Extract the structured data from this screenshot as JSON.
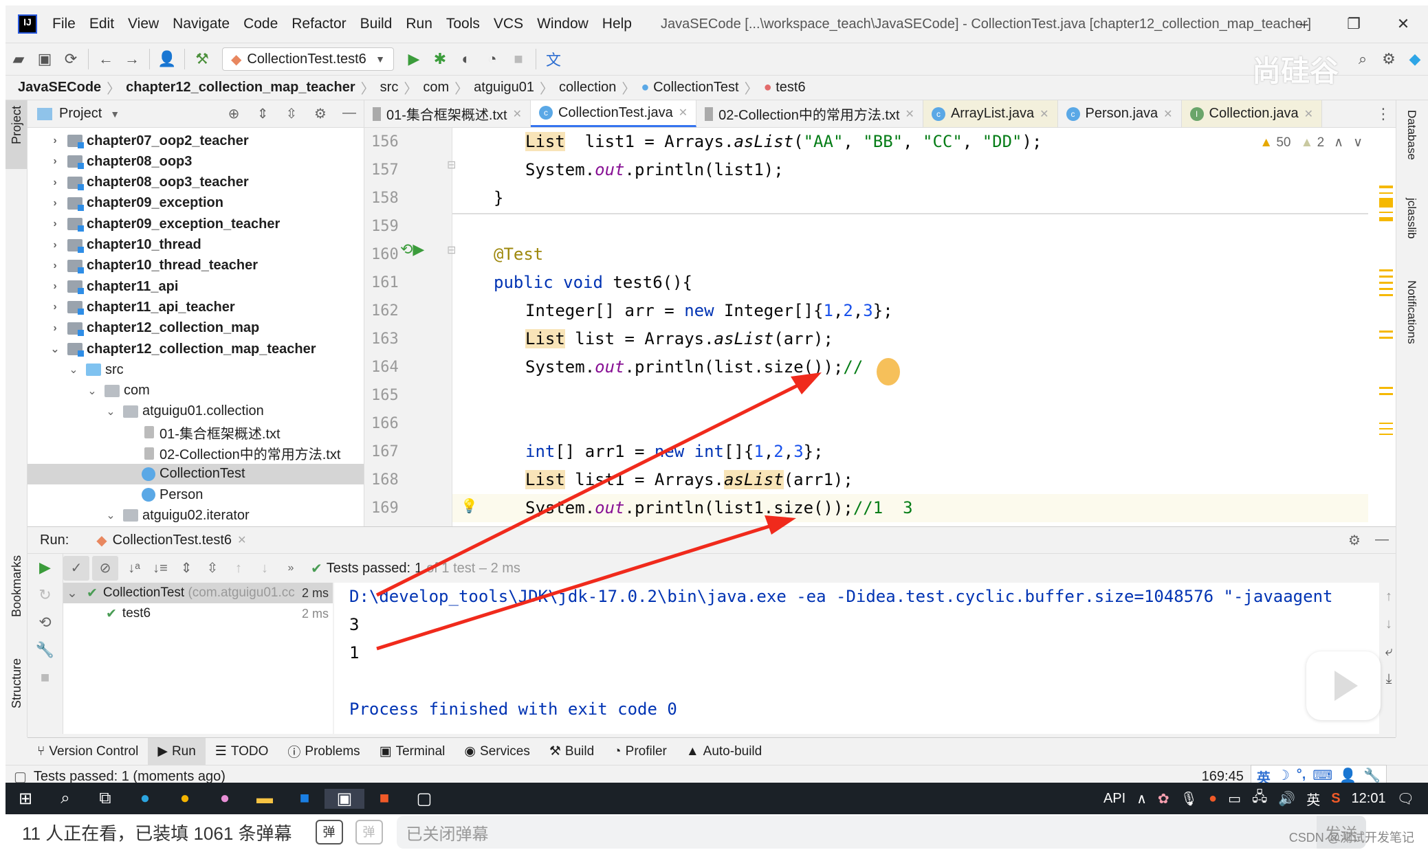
{
  "window": {
    "title": "JavaSECode [...\\workspace_teach\\JavaSECode] - CollectionTest.java [chapter12_collection_map_teacher]",
    "controls": [
      "–",
      "❐",
      "✕"
    ]
  },
  "menu": [
    "File",
    "Edit",
    "View",
    "Navigate",
    "Code",
    "Refactor",
    "Build",
    "Run",
    "Tools",
    "VCS",
    "Window",
    "Help"
  ],
  "toolbar": {
    "run_config": "CollectionTest.test6",
    "watermark": "尚硅谷"
  },
  "breadcrumb": [
    "JavaSECode",
    "chapter12_collection_map_teacher",
    "src",
    "com",
    "atguigu01",
    "collection",
    "CollectionTest",
    "test6"
  ],
  "left_stripe": {
    "project": "Project",
    "bookmarks": "Bookmarks",
    "structure": "Structure"
  },
  "right_stripe": {
    "database": "Database",
    "jclasslib": "jclasslib",
    "notifications": "Notifications"
  },
  "project_panel": {
    "title": "Project",
    "tree": [
      {
        "label": "chapter07_oop2_teacher",
        "depth": 0,
        "expanded": false,
        "type": "module"
      },
      {
        "label": "chapter08_oop3",
        "depth": 0,
        "expanded": false,
        "type": "module"
      },
      {
        "label": "chapter08_oop3_teacher",
        "depth": 0,
        "expanded": false,
        "type": "module"
      },
      {
        "label": "chapter09_exception",
        "depth": 0,
        "expanded": false,
        "type": "module"
      },
      {
        "label": "chapter09_exception_teacher",
        "depth": 0,
        "expanded": false,
        "type": "module"
      },
      {
        "label": "chapter10_thread",
        "depth": 0,
        "expanded": false,
        "type": "module"
      },
      {
        "label": "chapter10_thread_teacher",
        "depth": 0,
        "expanded": false,
        "type": "module"
      },
      {
        "label": "chapter11_api",
        "depth": 0,
        "expanded": false,
        "type": "module"
      },
      {
        "label": "chapter11_api_teacher",
        "depth": 0,
        "expanded": false,
        "type": "module"
      },
      {
        "label": "chapter12_collection_map",
        "depth": 0,
        "expanded": false,
        "type": "module"
      },
      {
        "label": "chapter12_collection_map_teacher",
        "depth": 0,
        "expanded": true,
        "type": "module"
      },
      {
        "label": "src",
        "depth": 1,
        "expanded": true,
        "type": "src"
      },
      {
        "label": "com",
        "depth": 2,
        "expanded": true,
        "type": "pkg"
      },
      {
        "label": "atguigu01.collection",
        "depth": 3,
        "expanded": true,
        "type": "pkg"
      },
      {
        "label": "01-集合框架概述.txt",
        "depth": 4,
        "type": "txt"
      },
      {
        "label": "02-Collection中的常用方法.txt",
        "depth": 4,
        "type": "txt"
      },
      {
        "label": "CollectionTest",
        "depth": 4,
        "type": "class",
        "selected": true
      },
      {
        "label": "Person",
        "depth": 4,
        "type": "class"
      },
      {
        "label": "atguigu02.iterator",
        "depth": 3,
        "expanded": true,
        "type": "pkg"
      }
    ]
  },
  "editor_tabs": [
    {
      "label": "01-集合框架概述.txt",
      "icon": "txt"
    },
    {
      "label": "CollectionTest.java",
      "icon": "class",
      "active": true
    },
    {
      "label": "02-Collection中的常用方法.txt",
      "icon": "txt"
    },
    {
      "label": "ArrayList.java",
      "icon": "class",
      "lib": true
    },
    {
      "label": "Person.java",
      "icon": "class"
    },
    {
      "label": "Collection.java",
      "icon": "interface",
      "lib": true
    }
  ],
  "inspections": {
    "warnings": "50",
    "weak_warnings": "2"
  },
  "code_lines": [
    {
      "n": "156",
      "indent": 2,
      "tokens": [
        [
          "hl",
          "List"
        ],
        [
          "",
          "  list1 = Arrays."
        ],
        [
          "itm",
          "asList"
        ],
        [
          "",
          "("
        ],
        [
          "str",
          "\"AA\""
        ],
        [
          "",
          ", "
        ],
        [
          "str",
          "\"BB\""
        ],
        [
          "",
          ", "
        ],
        [
          "str",
          "\"CC\""
        ],
        [
          "",
          ", "
        ],
        [
          "str",
          "\"DD\""
        ],
        [
          "",
          ");"
        ]
      ]
    },
    {
      "n": "157",
      "indent": 2,
      "tokens": [
        [
          "",
          "System."
        ],
        [
          "it",
          "out"
        ],
        [
          "",
          ".println(list1);"
        ]
      ]
    },
    {
      "n": "158",
      "indent": 1,
      "tokens": [
        [
          "",
          "}"
        ]
      ]
    },
    {
      "n": "159",
      "indent": 0,
      "tokens": []
    },
    {
      "n": "160",
      "indent": 1,
      "tokens": [
        [
          "ann",
          "@Test"
        ]
      ]
    },
    {
      "n": "161",
      "indent": 1,
      "tokens": [
        [
          "kw",
          "public void "
        ],
        [
          "",
          "test6(){"
        ]
      ]
    },
    {
      "n": "162",
      "indent": 2,
      "tokens": [
        [
          "",
          "Integer[] arr = "
        ],
        [
          "kw",
          "new "
        ],
        [
          "",
          "Integer[]{"
        ],
        [
          "num",
          "1"
        ],
        [
          "",
          ","
        ],
        [
          "num",
          "2"
        ],
        [
          "",
          ","
        ],
        [
          "num",
          "3"
        ],
        [
          "",
          "};"
        ]
      ]
    },
    {
      "n": "163",
      "indent": 2,
      "tokens": [
        [
          "hl",
          "List"
        ],
        [
          "",
          " list = Arrays."
        ],
        [
          "itm",
          "asList"
        ],
        [
          "",
          "(arr);"
        ]
      ]
    },
    {
      "n": "164",
      "indent": 2,
      "tokens": [
        [
          "",
          "System."
        ],
        [
          "it",
          "out"
        ],
        [
          "",
          ".println(list.size());"
        ],
        [
          "cmg",
          "//"
        ]
      ]
    },
    {
      "n": "165",
      "indent": 0,
      "tokens": []
    },
    {
      "n": "166",
      "indent": 0,
      "tokens": []
    },
    {
      "n": "167",
      "indent": 2,
      "tokens": [
        [
          "kw",
          "int"
        ],
        [
          "",
          "[] arr1 = "
        ],
        [
          "kw",
          "new int"
        ],
        [
          "",
          "[]{"
        ],
        [
          "num",
          "1"
        ],
        [
          "",
          ","
        ],
        [
          "num",
          "2"
        ],
        [
          "",
          ","
        ],
        [
          "num",
          "3"
        ],
        [
          "",
          "};"
        ]
      ]
    },
    {
      "n": "168",
      "indent": 2,
      "tokens": [
        [
          "hl",
          "List"
        ],
        [
          "",
          " list1 = Arrays."
        ],
        [
          "hl itm",
          "asList"
        ],
        [
          "",
          "(arr1);"
        ]
      ]
    },
    {
      "n": "169",
      "indent": 2,
      "tokens": [
        [
          "",
          "System."
        ],
        [
          "it",
          "out"
        ],
        [
          "",
          ".println(list1.size());"
        ],
        [
          "cmg",
          "//1  3"
        ]
      ]
    }
  ],
  "run_panel": {
    "label": "Run:",
    "tab": "CollectionTest.test6",
    "tests_passed_label": "Tests passed:",
    "tests_passed_count": "1",
    "tests_passed_detail": "of 1 test – 2 ms",
    "test_tree": [
      {
        "name": "CollectionTest",
        "pkg": "(com.atguigu01.cc",
        "time": "2 ms"
      },
      {
        "name": "test6",
        "time": "2 ms"
      }
    ],
    "console": [
      "D:\\develop_tools\\JDK\\jdk-17.0.2\\bin\\java.exe -ea -Didea.test.cyclic.buffer.size=1048576 \"-javaagent",
      "3",
      "1",
      "",
      "Process finished with exit code 0"
    ]
  },
  "bottom_tools": [
    "Version Control",
    "Run",
    "TODO",
    "Problems",
    "Terminal",
    "Services",
    "Build",
    "Profiler",
    "Auto-build"
  ],
  "status_bar": {
    "message": "Tests passed: 1 (moments ago)",
    "position": "169:45",
    "ime": [
      "英",
      "☽",
      "°,",
      "⌨",
      "👤",
      "🔧"
    ]
  },
  "taskbar": {
    "tray_text": "API",
    "ime": "英",
    "clock": "12:01"
  },
  "danmaku": {
    "viewers": "11 人正在看，已装填 1061 条弹幕",
    "icon_label": "弹",
    "input_placeholder": "已关闭弹幕",
    "send": "发送"
  },
  "attribution": "CSDN @测试开发笔记"
}
